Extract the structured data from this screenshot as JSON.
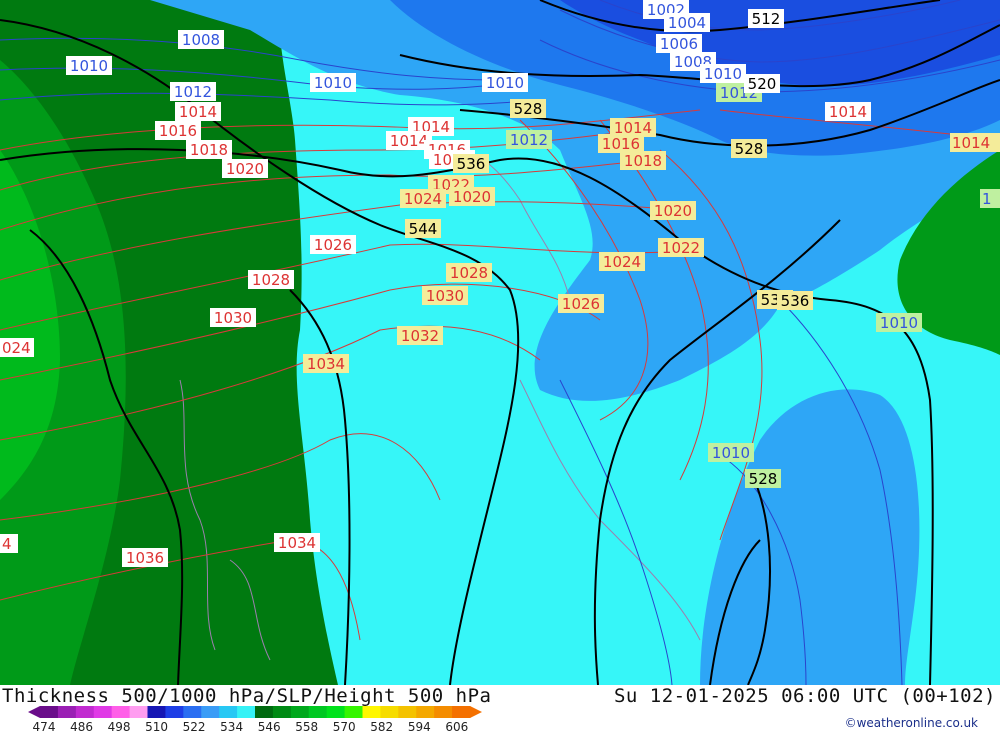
{
  "map": {
    "isobar_labels": [
      {
        "text": "1002",
        "color": "#3355dd"
      },
      {
        "text": "1004",
        "color": "#3355dd"
      },
      {
        "text": "1006",
        "color": "#3355dd"
      },
      {
        "text": "1008",
        "color": "#3355dd"
      },
      {
        "text": "1010",
        "color": "#3355dd"
      },
      {
        "text": "1008",
        "color": "#3355dd"
      },
      {
        "text": "1010",
        "color": "#3355dd"
      },
      {
        "text": "1012",
        "color": "#3355dd"
      },
      {
        "text": "1010",
        "color": "#3355dd"
      },
      {
        "text": "1010",
        "color": "#3355dd"
      },
      {
        "text": "1012",
        "color": "#3355dd"
      },
      {
        "text": "1012",
        "color": "#3355dd"
      },
      {
        "text": "1014",
        "color": "#dd3333"
      },
      {
        "text": "1016",
        "color": "#dd3333"
      },
      {
        "text": "1018",
        "color": "#dd3333"
      },
      {
        "text": "1020",
        "color": "#dd3333"
      },
      {
        "text": "1014",
        "color": "#dd3333"
      },
      {
        "text": "1014",
        "color": "#dd3333"
      },
      {
        "text": "1016",
        "color": "#dd3333"
      },
      {
        "text": "1018",
        "color": "#dd3333"
      },
      {
        "text": "1014",
        "color": "#dd3333"
      },
      {
        "text": "1016",
        "color": "#dd3333"
      },
      {
        "text": "1018",
        "color": "#dd3333"
      },
      {
        "text": "1020",
        "color": "#dd3333"
      },
      {
        "text": "1022",
        "color": "#dd3333"
      },
      {
        "text": "1024",
        "color": "#dd3333"
      },
      {
        "text": "1020",
        "color": "#dd3333"
      },
      {
        "text": "1022",
        "color": "#dd3333"
      },
      {
        "text": "1024",
        "color": "#dd3333"
      },
      {
        "text": "1026",
        "color": "#dd3333"
      },
      {
        "text": "1028",
        "color": "#dd3333"
      },
      {
        "text": "1030",
        "color": "#dd3333"
      },
      {
        "text": "1026",
        "color": "#dd3333"
      },
      {
        "text": "1028",
        "color": "#dd3333"
      },
      {
        "text": "1030",
        "color": "#dd3333"
      },
      {
        "text": "1032",
        "color": "#dd3333"
      },
      {
        "text": "1034",
        "color": "#dd3333"
      },
      {
        "text": "1036",
        "color": "#dd3333"
      },
      {
        "text": "1034",
        "color": "#dd3333"
      },
      {
        "text": "1014",
        "color": "#dd3333"
      },
      {
        "text": "1014",
        "color": "#dd3333"
      },
      {
        "text": "024",
        "color": "#dd3333"
      },
      {
        "text": "4",
        "color": "#dd3333"
      },
      {
        "text": "1",
        "color": "#3355dd"
      },
      {
        "text": "1010",
        "color": "#3355dd"
      },
      {
        "text": "1010",
        "color": "#3355dd"
      }
    ],
    "height_labels": [
      "512",
      "520",
      "528",
      "528",
      "536",
      "544",
      "536",
      "536",
      "528"
    ]
  },
  "footer": {
    "title": "Thickness 500/1000 hPa/SLP/Height 500 hPa",
    "valid_time": "Su 12-01-2025 06:00 UTC (00+102)",
    "credit": "©weatheronline.co.uk",
    "colorbar": {
      "ticks": [
        "474",
        "486",
        "498",
        "510",
        "522",
        "534",
        "546",
        "558",
        "570",
        "582",
        "594",
        "606"
      ],
      "colors": [
        "#6a0d8a",
        "#9a1fb4",
        "#c12bd0",
        "#e03ae6",
        "#ff5ee8",
        "#ff9df0",
        "#1616b4",
        "#1e3ee6",
        "#2a6ef2",
        "#3a9cf6",
        "#27c8f4",
        "#36f2f6",
        "#006a10",
        "#008a14",
        "#00a81c",
        "#00c822",
        "#00e21c",
        "#35f500",
        "#fff700",
        "#f6dc00",
        "#f4c200",
        "#f4a800",
        "#f48c00",
        "#f47000"
      ]
    }
  }
}
